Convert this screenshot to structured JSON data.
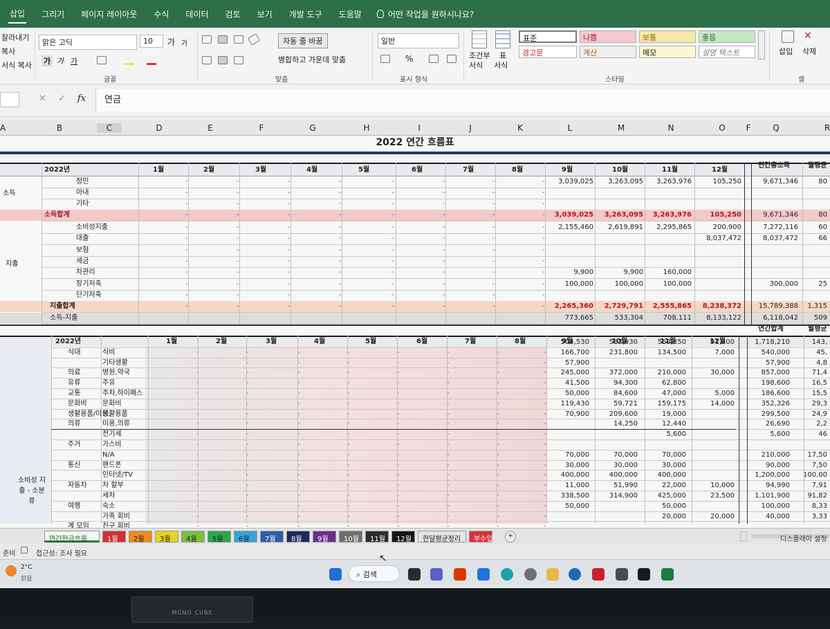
{
  "menu_tabs": [
    "삽입",
    "그리기",
    "페이지 레이아웃",
    "수식",
    "데이터",
    "검토",
    "보기",
    "개발 도구",
    "도움말"
  ],
  "tell_me": "어떤 작업을 원하시나요?",
  "clipboard": {
    "cut": "잘라내기",
    "copy": "복사",
    "format": "서식 복사"
  },
  "font": {
    "name": "맑은 고딕",
    "size": "10",
    "bold": "가",
    "italic": "가",
    "underline": "가",
    "grow": "가",
    "shrink": "가",
    "group": "글꼴"
  },
  "align": {
    "wrap": "자동 줄 바꿈",
    "merge": "병합하고 가운데 맞춤",
    "group": "맞춤"
  },
  "number": {
    "format": "일반",
    "percent": "%",
    "group": "표시 형식"
  },
  "styles": {
    "cond": "조건부",
    "cond2": "서식",
    "table": "표",
    "table2": "서식",
    "normal": "표준",
    "bad": "나쁨",
    "good": "보통",
    "neutral": "좋음",
    "warn": "경고문",
    "calc": "계산",
    "memo": "메모",
    "explain": "설명 텍스트",
    "group": "스타일"
  },
  "cells": {
    "insert": "삽입",
    "delete": "삭제",
    "group": "셀"
  },
  "formula": {
    "value": "연금",
    "fx": "fx"
  },
  "columns": [
    "A",
    "B",
    "C",
    "D",
    "E",
    "F",
    "G",
    "H",
    "I",
    "J",
    "K",
    "L",
    "M",
    "N",
    "O",
    "F",
    "Q",
    "R"
  ],
  "sheet": {
    "title": "2022 연간 흐름표",
    "year": "2022년",
    "months": [
      "1월",
      "2월",
      "3월",
      "4월",
      "5월",
      "6월",
      "7월",
      "8월",
      "9월",
      "10월",
      "11월",
      "12월"
    ],
    "annual_total": "연간총소득",
    "monthly_avg": "월평균",
    "income_label": "소득",
    "income_rows": [
      {
        "name": "정민",
        "sep": "3,039,025",
        "oct": "3,263,095",
        "nov": "3,263,976",
        "dec": "105,250",
        "total": "9,671,346",
        "avg": "80"
      },
      {
        "name": "아내",
        "sep": "",
        "oct": "",
        "nov": "",
        "dec": "",
        "total": "",
        "avg": ""
      },
      {
        "name": "기타",
        "sep": "",
        "oct": "",
        "nov": "",
        "dec": "",
        "total": "",
        "avg": ""
      }
    ],
    "income_sum": {
      "name": "소득합계",
      "sep": "3,039,025",
      "oct": "3,263,095",
      "nov": "3,263,976",
      "dec": "105,250",
      "total": "9,671,346",
      "avg": "80"
    },
    "expense_label": "지출",
    "expense_rows": [
      {
        "name": "소비성지출",
        "sep": "2,155,460",
        "oct": "2,619,891",
        "nov": "2,295,865",
        "dec": "200,900",
        "total": "7,272,116",
        "avg": "60"
      },
      {
        "name": "대출",
        "sep": "",
        "oct": "",
        "nov": "",
        "dec": "8,037,472",
        "total": "8,037,472",
        "avg": "66"
      },
      {
        "name": "보험",
        "sep": "",
        "oct": "",
        "nov": "",
        "dec": "",
        "total": "",
        "avg": ""
      },
      {
        "name": "세금",
        "sep": "",
        "oct": "",
        "nov": "",
        "dec": "",
        "total": "",
        "avg": ""
      },
      {
        "name": "차관리",
        "sep": "9,900",
        "oct": "9,900",
        "nov": "160,000",
        "dec": "",
        "total": "",
        "avg": ""
      },
      {
        "name": "장기저축",
        "sep": "100,000",
        "oct": "100,000",
        "nov": "100,000",
        "dec": "",
        "total": "300,000",
        "avg": "25"
      },
      {
        "name": "단기저축",
        "sep": "",
        "oct": "",
        "nov": "",
        "dec": "",
        "total": "",
        "avg": ""
      }
    ],
    "expense_sum": {
      "name": "지출합계",
      "sep": "2,265,360",
      "oct": "2,729,791",
      "nov": "2,555,865",
      "dec": "8,238,372",
      "total": "15,789,388",
      "avg": "1,315"
    },
    "net": {
      "name": "소득-지출",
      "sep": "773,665",
      "oct": "533,304",
      "nov": "708,111",
      "dec": "8,133,122",
      "total": "6,118,042",
      "avg": "509"
    },
    "annual_sum": "연간합계",
    "consumption_label": "소비성 지출 - 소분류",
    "detail_rows": [
      {
        "cat": "",
        "name": "",
        "sep": "504,530",
        "oct": "563,930",
        "nov": "558,350",
        "dec": "91,400",
        "total": "1,718,210",
        "avg": "143,"
      },
      {
        "cat": "식대",
        "name": "식비",
        "sep": "166,700",
        "oct": "231,800",
        "nov": "134,500",
        "dec": "7,000",
        "total": "540,000",
        "avg": "45,"
      },
      {
        "cat": "",
        "name": "기타생활",
        "sep": "57,900",
        "oct": "",
        "nov": "",
        "dec": "",
        "total": "57,900",
        "avg": "4,8"
      },
      {
        "cat": "의료",
        "name": "병원,약국",
        "sep": "245,000",
        "oct": "372,000",
        "nov": "210,000",
        "dec": "30,000",
        "total": "857,000",
        "avg": "71,4"
      },
      {
        "cat": "유류",
        "name": "주유",
        "sep": "41,500",
        "oct": "94,300",
        "nov": "62,800",
        "dec": "",
        "total": "198,600",
        "avg": "16,5"
      },
      {
        "cat": "교통",
        "name": "주차,하이패스",
        "sep": "50,000",
        "oct": "84,600",
        "nov": "47,000",
        "dec": "5,000",
        "total": "186,600",
        "avg": "15,5"
      },
      {
        "cat": "문화비",
        "name": "문화비",
        "sep": "119,430",
        "oct": "59,721",
        "nov": "159,175",
        "dec": "14,000",
        "total": "352,326",
        "avg": "29,3"
      },
      {
        "cat": "생활용품/미용,",
        "name": "생활용품",
        "sep": "70,900",
        "oct": "209,600",
        "nov": "19,000",
        "dec": "",
        "total": "299,500",
        "avg": "24,9"
      },
      {
        "cat": "의류",
        "name": "미용,의류",
        "sep": "",
        "oct": "14,250",
        "nov": "12,440",
        "dec": "",
        "total": "26,690",
        "avg": "2,2"
      },
      {
        "cat": "",
        "name": "전기세",
        "sep": "",
        "oct": "",
        "nov": "5,600",
        "dec": "",
        "total": "5,600",
        "avg": "46"
      },
      {
        "cat": "주거",
        "name": "가스비",
        "sep": "",
        "oct": "",
        "nov": "",
        "dec": "",
        "total": "",
        "avg": ""
      },
      {
        "cat": "",
        "name": "N/A",
        "sep": "70,000",
        "oct": "70,000",
        "nov": "70,000",
        "dec": "",
        "total": "210,000",
        "avg": "17,50"
      },
      {
        "cat": "통신",
        "name": "핸드폰",
        "sep": "30,000",
        "oct": "30,000",
        "nov": "30,000",
        "dec": "",
        "total": "90,000",
        "avg": "7,50"
      },
      {
        "cat": "",
        "name": "인터넷/TV",
        "sep": "400,000",
        "oct": "400,000",
        "nov": "400,000",
        "dec": "",
        "total": "1,200,000",
        "avg": "100,00"
      },
      {
        "cat": "자동차",
        "name": "차 할부",
        "sep": "11,000",
        "oct": "51,990",
        "nov": "22,000",
        "dec": "10,000",
        "total": "94,990",
        "avg": "7,91"
      },
      {
        "cat": "",
        "name": "세차",
        "sep": "338,500",
        "oct": "314,900",
        "nov": "425,000",
        "dec": "23,500",
        "total": "1,101,900",
        "avg": "91,82"
      },
      {
        "cat": "여행",
        "name": "숙소",
        "sep": "50,000",
        "oct": "",
        "nov": "50,000",
        "dec": "",
        "total": "100,000",
        "avg": "8,33"
      },
      {
        "cat": "",
        "name": "가족 회비",
        "sep": "",
        "oct": "",
        "nov": "20,000",
        "dec": "20,000",
        "total": "40,000",
        "avg": "3,33"
      },
      {
        "cat": "계 모임",
        "name": "친구 회비",
        "sep": "",
        "oct": "",
        "nov": "",
        "dec": "",
        "total": "",
        "avg": ""
      }
    ]
  },
  "sheet_tabs": [
    {
      "label": "연간현금흐름",
      "bg": "#2e7d32",
      "fg": "#ffffff"
    },
    {
      "label": "1월",
      "bg": "#d32f2f",
      "fg": "#ffffff"
    },
    {
      "label": "2월",
      "bg": "#ef8a1f",
      "fg": "#222222"
    },
    {
      "label": "3월",
      "bg": "#e6d321",
      "fg": "#222222"
    },
    {
      "label": "4월",
      "bg": "#7cbf42",
      "fg": "#222222"
    },
    {
      "label": "5월",
      "bg": "#2aa84a",
      "fg": "#222222"
    },
    {
      "label": "6월",
      "bg": "#3aa3d8",
      "fg": "#222222"
    },
    {
      "label": "7월",
      "bg": "#2f5da8",
      "fg": "#ffffff"
    },
    {
      "label": "8월",
      "bg": "#1d2a5a",
      "fg": "#ffffff"
    },
    {
      "label": "9월",
      "bg": "#6b2f8e",
      "fg": "#ffffff"
    },
    {
      "label": "10월",
      "bg": "#6e6e6e",
      "fg": "#ffffff"
    },
    {
      "label": "11월",
      "bg": "#2c2c2c",
      "fg": "#ffffff"
    },
    {
      "label": "12월",
      "bg": "#151515",
      "fg": "#ffffff"
    },
    {
      "label": "한달평균정리",
      "bg": "#e4e4e4",
      "fg": "#222222"
    },
    {
      "label": "부수입",
      "bg": "#d8313b",
      "fg": "#ffffff"
    }
  ],
  "status": {
    "ready": "준비",
    "accessibility": "접근성: 조사 필요",
    "display": "디스플레이 설정"
  },
  "taskbar": {
    "search": "검색",
    "weather_temp": "2°C",
    "weather_text": "맑음"
  },
  "monitor_brand": "MONO CUBE"
}
